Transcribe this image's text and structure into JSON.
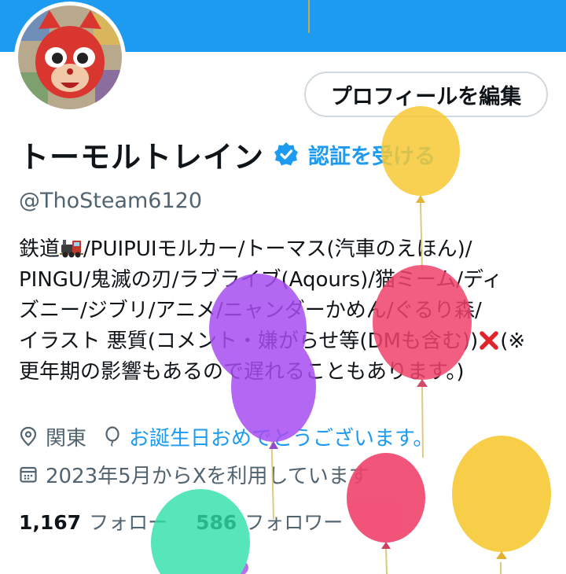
{
  "profile": {
    "display_name": "トーモルトレイン",
    "verify_label": "認証を受ける",
    "handle": "@ThoSteam6120",
    "edit_button_label": "プロフィールを編集"
  },
  "bio": {
    "line1_a": "鉄道",
    "line1_b": "/PUIPUIモルカー/トーマス(汽車のえほん)/",
    "line2": "PINGU/鬼滅の刃/ラブライブ(Aqours)/猫ミーム/ディ",
    "line3": "ズニー/ジブリ/アニメ/ニャンダーかめん/ぐるり森/",
    "line4_a": "イラスト 悪質(コメント・嫌がらせ等(DMも含む))",
    "line4_b": "(※",
    "line5": "更年期の影響もあるので遅れることもあります。)"
  },
  "meta": {
    "location": "関東",
    "birthday_text": "お誕生日おめでとうございます。",
    "joined": "2023年5月からXを利用しています"
  },
  "stats": {
    "following_count": "1,167",
    "following_label": "フォロー",
    "followers_count": "586",
    "followers_label": "フォロワー"
  },
  "colors": {
    "accent": "#1d9bf0",
    "secondary_text": "#536471",
    "balloon_yellow": "#f7c934",
    "balloon_red": "#f0426a",
    "balloon_purple": "#a64df0",
    "balloon_green": "#2de0a8"
  },
  "icons": [
    "verified-badge-icon",
    "train-emoji-icon",
    "cross-mark-icon",
    "location-pin-icon",
    "balloon-icon",
    "calendar-icon"
  ]
}
